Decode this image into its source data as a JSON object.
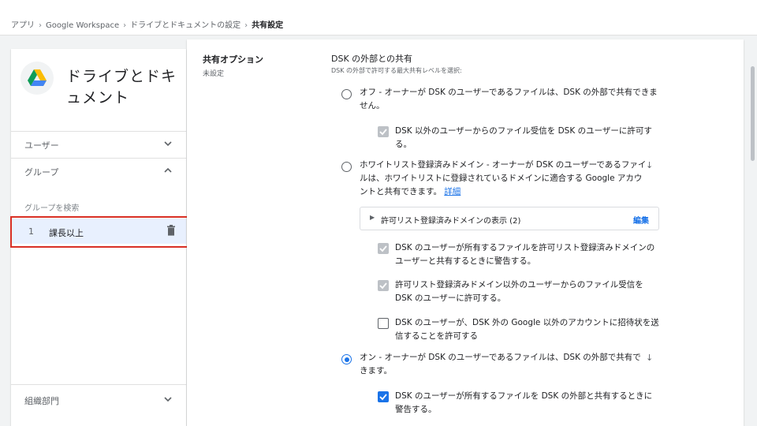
{
  "breadcrumb": [
    "アプリ",
    "Google Workspace",
    "ドライブとドキュメントの設定",
    "共有設定"
  ],
  "breadcrumb_separator": "›",
  "sidebar": {
    "app_title": "ドライブとドキュメント",
    "nav": [
      {
        "label": "ユーザー",
        "expanded": false
      },
      {
        "label": "グループ",
        "expanded": true
      }
    ],
    "group_search_placeholder": "グループを検索",
    "groups": [
      {
        "index": "1",
        "name": "課長以上"
      }
    ],
    "org_unit_label": "組織部門"
  },
  "main": {
    "section_title": "共有オプション",
    "section_status": "未設定",
    "setting_title": "DSK の外部との共有",
    "setting_subtitle": "DSK の外部で許可する最大共有レベルを選択:",
    "options": [
      {
        "selected": false,
        "text": "オフ - オーナーが DSK のユーザーであるファイルは、DSK の外部で共有できません。"
      },
      {
        "selected": false,
        "text": "ホワイトリスト登録済みドメイン - オーナーが DSK のユーザーであるファイルは、ホワイトリストに登録されているドメインに適合する Google アカウントと共有できます。",
        "link": "詳細"
      },
      {
        "selected": true,
        "text": "オン - オーナーが DSK のユーザーであるファイルは、DSK の外部で共有できます。"
      }
    ],
    "sub_options": [
      {
        "state": "disabled",
        "text": "DSK 以外のユーザーからのファイル受信を DSK のユーザーに許可する。"
      },
      {
        "state": "disabled",
        "text": "DSK のユーザーが所有するファイルを許可リスト登録済みドメインのユーザーと共有するときに警告する。"
      },
      {
        "state": "disabled",
        "text": "許可リスト登録済みドメイン以外のユーザーからのファイル受信を DSK のユーザーに許可する。"
      },
      {
        "state": "unchecked",
        "text": "DSK のユーザーが、DSK 外の Google 以外のアカウントに招待状を送信することを許可する"
      },
      {
        "state": "checked",
        "text": "DSK のユーザーが所有するファイルを DSK の外部と共有するときに警告する。"
      }
    ],
    "allowlist": {
      "label": "許可リスト登録済みドメインの表示 (2)",
      "edit": "編集"
    },
    "arrow_glyph": "↓"
  },
  "colors": {
    "accent": "#1a73e8",
    "highlight_border": "#d93025"
  }
}
